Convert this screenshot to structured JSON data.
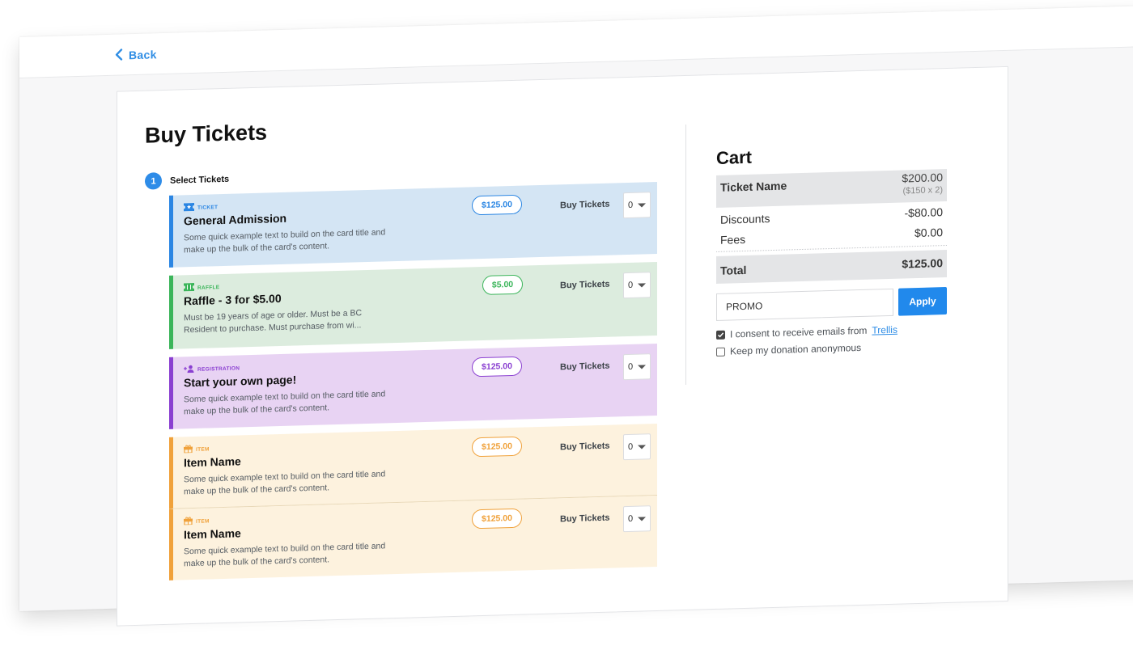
{
  "nav": {
    "back_label": "Back"
  },
  "page": {
    "title": "Buy Tickets",
    "step_number": "1",
    "step_label": "Select Tickets"
  },
  "tickets": [
    {
      "category": "TICKET",
      "icon": "ticket-icon",
      "name": "General Admission",
      "description": "Some quick example text to build on the card title and make up the bulk of the card's content.",
      "price": "$125.00",
      "buy_label": "Buy Tickets",
      "quantity": "0",
      "accent": "#2b86e3",
      "bg": "#d4e5f4"
    },
    {
      "category": "RAFFLE",
      "icon": "raffle-ticket-icon",
      "name": "Raffle - 3 for $5.00",
      "description": "Must be 19 years of age or older. Must be a BC Resident to purchase. Must purchase from wi...",
      "price": "$5.00",
      "buy_label": "Buy Tickets",
      "quantity": "0",
      "accent": "#3bb55a",
      "bg": "#dcecde"
    },
    {
      "category": "REGISTRATION",
      "icon": "add-user-icon",
      "name": "Start your own page!",
      "description": "Some quick example text to build on the card title and make up the bulk of the card's content.",
      "price": "$125.00",
      "buy_label": "Buy Tickets",
      "quantity": "0",
      "accent": "#8a3fd1",
      "bg": "#e8d3f3"
    },
    {
      "category": "ITEM",
      "icon": "gift-icon",
      "name": "Item Name",
      "description": "Some quick example text to build on the card title and make up the bulk of the card's content.",
      "price": "$125.00",
      "buy_label": "Buy Tickets",
      "quantity": "0",
      "accent": "#f0a13a",
      "bg": "#fdf2de"
    },
    {
      "category": "ITEM",
      "icon": "gift-icon",
      "name": "Item Name",
      "description": "Some quick example text to build on the card title and make up the bulk of the card's content.",
      "price": "$125.00",
      "buy_label": "Buy Tickets",
      "quantity": "0",
      "accent": "#f0a13a",
      "bg": "#fdf2de"
    }
  ],
  "cart": {
    "title": "Cart",
    "ticket_label": "Ticket Name",
    "ticket_amount": "$200.00",
    "ticket_detail": "($150 x 2)",
    "discounts_label": "Discounts",
    "discounts_amount": "-$80.00",
    "fees_label": "Fees",
    "fees_amount": "$0.00",
    "total_label": "Total",
    "total_amount": "$125.00",
    "promo_value": "PROMO",
    "apply_label": "Apply",
    "consent_text": "I consent to receive emails from",
    "consent_link": "Trellis",
    "consent_checked": true,
    "anonymous_text": "Keep my donation anonymous",
    "anonymous_checked": false
  }
}
